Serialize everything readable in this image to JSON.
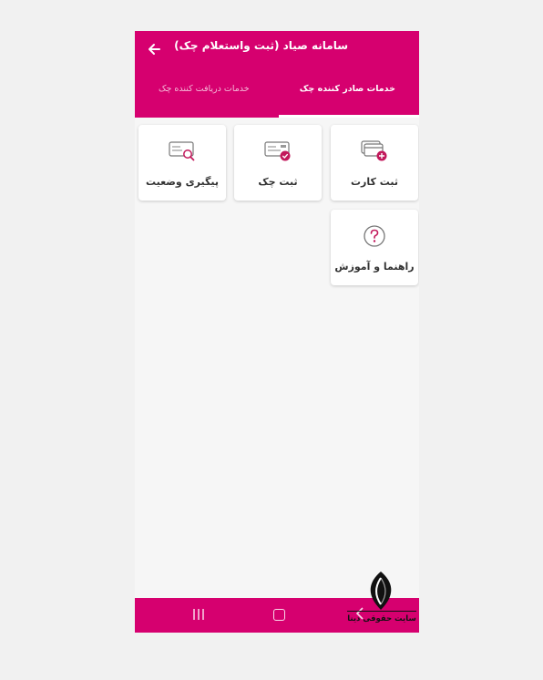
{
  "header": {
    "title": "سامانه صیاد (ثبت واستعلام چک)",
    "back_icon": "arrow-back-icon"
  },
  "tabs": [
    {
      "label": "خدمات صادر کننده چک",
      "active": true
    },
    {
      "label": "خدمات دریافت کننده چک",
      "active": false
    }
  ],
  "services": [
    {
      "label": "ثبت کارت",
      "icon": "card-add-icon"
    },
    {
      "label": "ثبت چک",
      "icon": "check-register-icon"
    },
    {
      "label": "پیگیری وضعیت",
      "icon": "check-search-icon"
    },
    {
      "label": "راهنما و آموزش",
      "icon": "help-icon"
    }
  ],
  "navbar": {
    "icons": [
      "recents-icon",
      "home-icon",
      "back-icon"
    ]
  },
  "watermark": {
    "text": "سایت حقوقی دینا",
    "icon": "leaf-logo-icon"
  },
  "colors": {
    "accent": "#d6006f",
    "background": "#f6f6f6",
    "card": "#ffffff"
  }
}
